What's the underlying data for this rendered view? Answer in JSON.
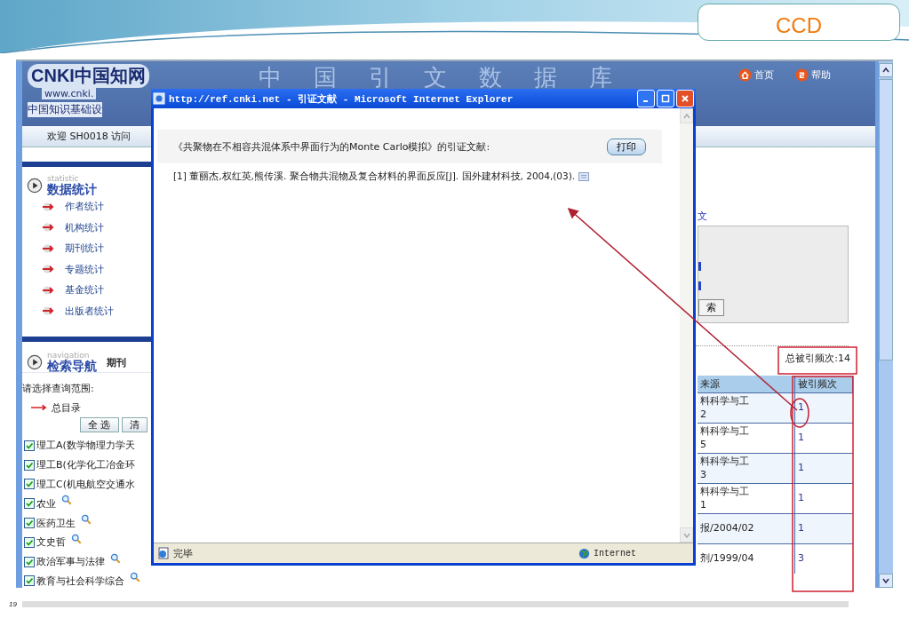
{
  "slide": {
    "title": "CCD",
    "page_number": "19"
  },
  "header": {
    "logo": "CNKI中国知网",
    "logo_url": "www.cnki.",
    "tagline": "中国知识基础设",
    "banner": [
      "中",
      "国",
      "引",
      "文",
      "数",
      "据",
      "库"
    ],
    "links": [
      {
        "label": "首页",
        "kind": "home"
      },
      {
        "label": "帮助",
        "kind": "help"
      }
    ]
  },
  "welcome": "欢迎 SH0018 访问",
  "statistic": {
    "subtitle": "statistic",
    "title": "数据统计",
    "items": [
      "作者统计",
      "机构统计",
      "期刊统计",
      "专题统计",
      "基金统计",
      "出版者统计"
    ]
  },
  "navigation": {
    "subtitle": "navigation",
    "title": "检索导航",
    "tab": "期刊",
    "prompt": "请选择查询范围:",
    "root": "总目录",
    "buttons": [
      "全 选",
      "清"
    ],
    "categories": [
      {
        "label": "理工A(数学物理力学天",
        "checked": true,
        "search_icon": false
      },
      {
        "label": "理工B(化学化工冶金环",
        "checked": true,
        "search_icon": false
      },
      {
        "label": "理工C(机电航空交通水",
        "checked": true,
        "search_icon": false
      },
      {
        "label": "农业",
        "checked": true,
        "search_icon": true
      },
      {
        "label": "医药卫生",
        "checked": true,
        "search_icon": true
      },
      {
        "label": "文史哲",
        "checked": true,
        "search_icon": true
      },
      {
        "label": "政治军事与法律",
        "checked": true,
        "search_icon": true
      },
      {
        "label": "教育与社会科学综合",
        "checked": true,
        "search_icon": true
      }
    ]
  },
  "results": {
    "link": "文",
    "search_button": "索",
    "total": "总被引频次:14",
    "columns": [
      "来源",
      "被引频次"
    ],
    "rows": [
      {
        "source": [
          "料科学与工",
          "2"
        ],
        "count": "1"
      },
      {
        "source": [
          "料科学与工",
          "5"
        ],
        "count": "1"
      },
      {
        "source": [
          "料科学与工",
          "3"
        ],
        "count": "1"
      },
      {
        "source": [
          "料科学与工",
          "1"
        ],
        "count": "1"
      },
      {
        "source": [
          "报/2004/02"
        ],
        "count": "1"
      },
      {
        "source": [
          "剂/1999/04"
        ],
        "count": "3"
      }
    ]
  },
  "popup": {
    "title": "http://ref.cnki.net - 引证文献 - Microsoft Internet Explorer",
    "heading": "《共聚物在不相容共混体系中界面行为的Monte Carlo模拟》的引证文献:",
    "print_button": "打印",
    "citations": [
      "[1] 董丽杰,权红英,熊传溪. 聚合物共混物及复合材料的界面反应[J]. 国外建材科技, 2004,(03)."
    ],
    "status": "完毕",
    "zone": "Internet"
  }
}
